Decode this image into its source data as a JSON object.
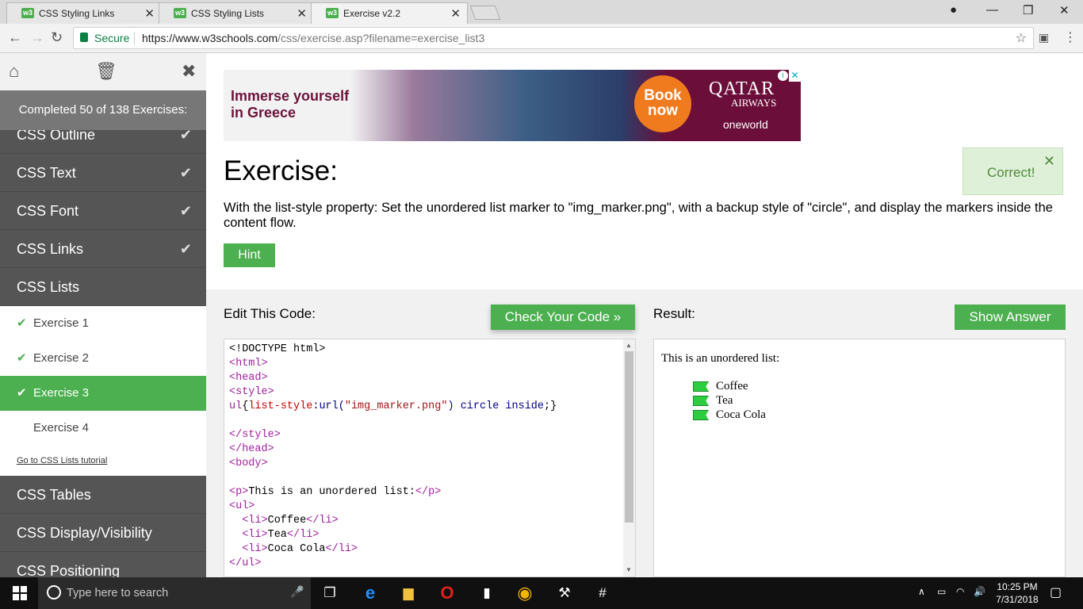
{
  "browser": {
    "tabs": [
      {
        "label": "CSS Styling Links",
        "favicon": "w3"
      },
      {
        "label": "CSS Styling Lists",
        "favicon": "w3"
      },
      {
        "label": "Exercise v2.2",
        "favicon": "w3"
      }
    ],
    "secure_label": "Secure",
    "url_main": "https://www.w3schools.com",
    "url_rest": "/css/exercise.asp?filename=exercise_list3"
  },
  "sidebar": {
    "progress": "Completed 50 of 138 Exercises:",
    "items": [
      {
        "label": "CSS Outline",
        "done": true
      },
      {
        "label": "CSS Text",
        "done": true
      },
      {
        "label": "CSS Font",
        "done": true
      },
      {
        "label": "CSS Links",
        "done": true
      },
      {
        "label": "CSS Lists",
        "done": false
      }
    ],
    "subitems": [
      {
        "label": "Exercise 1",
        "done": true
      },
      {
        "label": "Exercise 2",
        "done": true
      },
      {
        "label": "Exercise 3",
        "done": true,
        "active": true
      },
      {
        "label": "Exercise 4",
        "done": false
      }
    ],
    "tutorial_link": "Go to CSS Lists tutorial",
    "more_items": [
      {
        "label": "CSS Tables"
      },
      {
        "label": "CSS Display/Visibility"
      },
      {
        "label": "CSS Positioning"
      }
    ]
  },
  "ad": {
    "headline_line1": "Immerse yourself",
    "headline_line2": "in Greece",
    "book_line1": "Book",
    "book_line2": "now",
    "brand": "QATAR",
    "brand_sub": "AIRWAYS",
    "alliance": "oneworld"
  },
  "exercise": {
    "title": "Exercise:",
    "correct": "Correct!",
    "description": "With the list-style property: Set the unordered list marker to \"img_marker.png\", with a backup style of \"circle\", and display the markers inside the content flow.",
    "hint": "Hint",
    "edit_label": "Edit This Code:",
    "check_button": "Check Your Code »",
    "result_label": "Result:",
    "show_answer": "Show Answer"
  },
  "result": {
    "paragraph": "This is an unordered list:",
    "items": [
      "Coffee",
      "Tea",
      "Coca Cola"
    ]
  },
  "taskbar": {
    "search_placeholder": "Type here to search",
    "time": "10:25 PM",
    "date": "7/31/2018"
  },
  "colors": {
    "accent": "#4caf50",
    "sidebar": "#555555",
    "correct_bg": "#dff0d8"
  }
}
